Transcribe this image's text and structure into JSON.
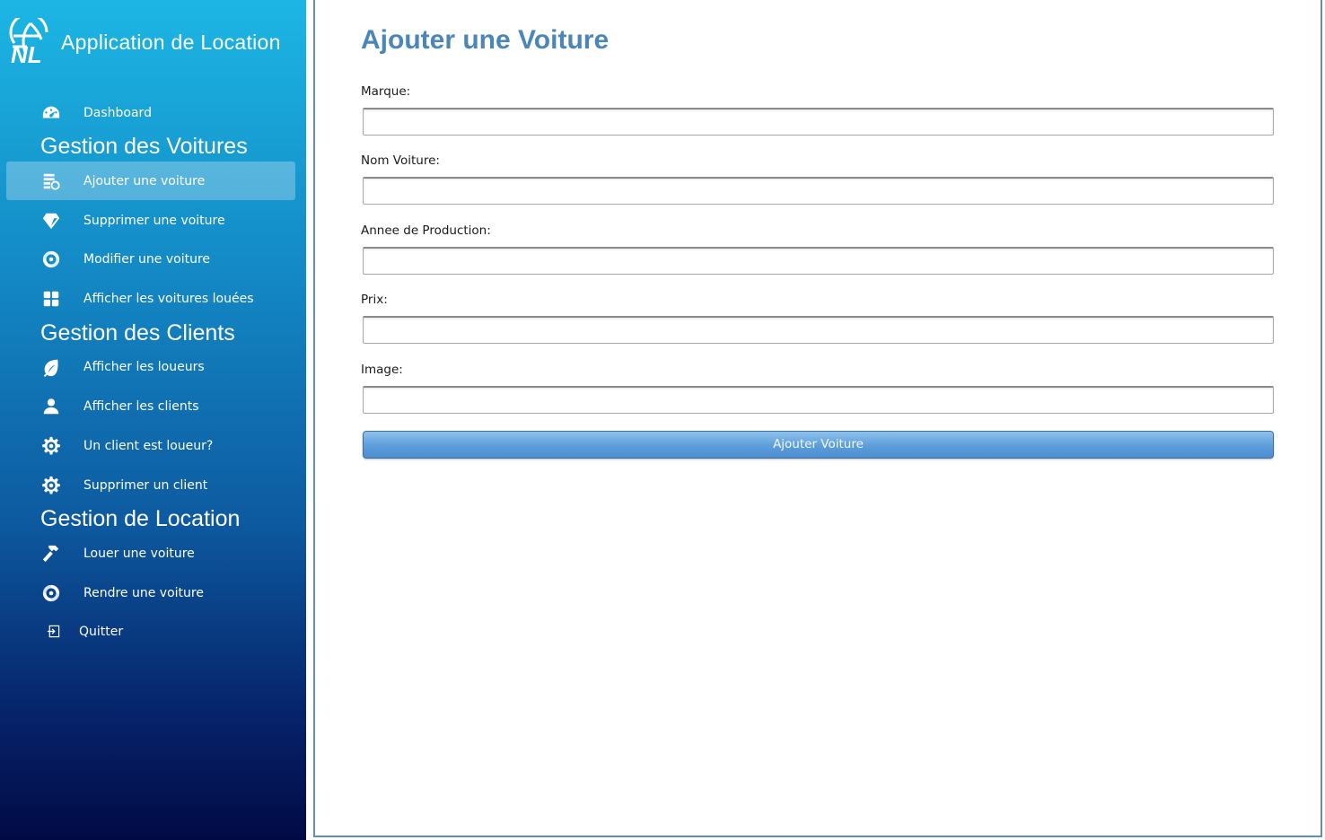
{
  "app": {
    "title": "Application de Location",
    "logo_text": "NL"
  },
  "sidebar": {
    "dashboard": {
      "label": "Dashboard",
      "icon": "speedometer-icon"
    },
    "sections": [
      {
        "title": "Gestion des Voitures",
        "items": [
          {
            "label": "Ajouter une voiture",
            "icon": "list-add-icon",
            "active": true
          },
          {
            "label": "Supprimer une voiture",
            "icon": "gem-icon",
            "active": false
          },
          {
            "label": "Modifier une voiture",
            "icon": "swirl-icon",
            "active": false
          },
          {
            "label": "Afficher les voitures louées",
            "icon": "grid-icon",
            "active": false
          }
        ]
      },
      {
        "title": "Gestion des Clients",
        "items": [
          {
            "label": "Afficher les loueurs",
            "icon": "leaf-icon"
          },
          {
            "label": "Afficher les clients",
            "icon": "user-icon"
          },
          {
            "label": "Un client est loueur?",
            "icon": "gear-icon"
          },
          {
            "label": "Supprimer un client",
            "icon": "gear-icon"
          }
        ]
      },
      {
        "title": "Gestion de Location",
        "items": [
          {
            "label": "Louer une voiture",
            "icon": "hammer-icon"
          },
          {
            "label": "Rendre une voiture",
            "icon": "swirl-icon"
          }
        ]
      }
    ],
    "quit": {
      "label": "Quitter",
      "icon": "exit-icon"
    }
  },
  "main": {
    "title": "Ajouter une Voiture",
    "fields": [
      {
        "label": "Marque:",
        "value": ""
      },
      {
        "label": "Nom Voiture:",
        "value": ""
      },
      {
        "label": "Annee de Production:",
        "value": ""
      },
      {
        "label": "Prix:",
        "value": ""
      },
      {
        "label": "Image:",
        "value": ""
      }
    ],
    "submit_label": "Ajouter Voiture"
  },
  "colors": {
    "accent": "#4a86b8",
    "sidebar_top": "#1cb6e4",
    "sidebar_bottom": "#020a45",
    "button": "#5fa0dc"
  }
}
